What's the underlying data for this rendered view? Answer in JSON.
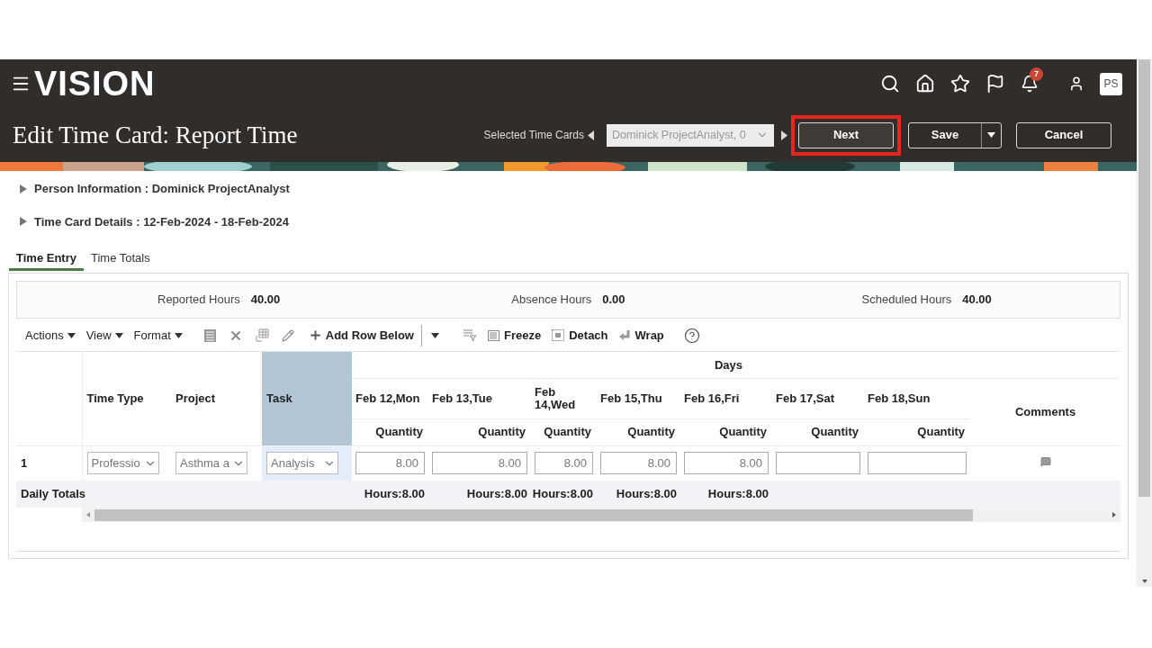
{
  "app": {
    "logo": "VISION",
    "notification_count": "7",
    "avatar": "PS"
  },
  "page_title": "Edit Time Card: Report Time",
  "selector": {
    "label": "Selected Time Cards",
    "value": "Dominick ProjectAnalyst, 0"
  },
  "buttons": [
    {
      "label": "Next",
      "highlighted": true
    },
    {
      "label": "Save",
      "highlighted": false
    },
    {
      "label": "Cancel",
      "highlighted": false
    }
  ],
  "sections": [
    {
      "label": "Person Information : Dominick ProjectAnalyst",
      "expanded": false
    },
    {
      "label": "Time Card Details : 12-Feb-2024 - 18-Feb-2024",
      "expanded": false
    }
  ],
  "tabs": [
    {
      "label": "Time Entry",
      "selected": true
    },
    {
      "label": "Time Totals",
      "selected": false
    }
  ],
  "summary": [
    {
      "label": "Reported Hours",
      "value": "40.00"
    },
    {
      "label": "Absence Hours",
      "value": "0.00"
    },
    {
      "label": "Scheduled Hours",
      "value": "40.00"
    }
  ],
  "toolbar": {
    "menus": [
      "Actions",
      "View",
      "Format"
    ],
    "add_row": "Add Row Below",
    "freeze": "Freeze",
    "detach": "Detach",
    "wrap": "Wrap"
  },
  "table": {
    "columns": [
      {
        "label": "Time Type",
        "selected": false
      },
      {
        "label": "Project",
        "selected": false
      },
      {
        "label": "Task",
        "selected": true
      }
    ],
    "group_label": "Days",
    "days": [
      {
        "date": "Feb 12,Mon",
        "unit": "Quantity"
      },
      {
        "date": "Feb 13,Tue",
        "unit": "Quantity"
      },
      {
        "date": "Feb 14,Wed",
        "unit": "Quantity"
      },
      {
        "date": "Feb 15,Thu",
        "unit": "Quantity"
      },
      {
        "date": "Feb 16,Fri",
        "unit": "Quantity"
      },
      {
        "date": "Feb 17,Sat",
        "unit": "Quantity"
      },
      {
        "date": "Feb 18,Sun",
        "unit": "Quantity"
      }
    ],
    "comments_label": "Comments",
    "rows": [
      {
        "number": "1",
        "cells": [
          "Professio",
          "Asthma a",
          "Analysis"
        ],
        "quantities": [
          "8.00",
          "8.00",
          "8.00",
          "8.00",
          "8.00"
        ]
      }
    ],
    "totals": {
      "label": "Daily Totals",
      "values": [
        "Hours:8.00",
        "Hours:8.00",
        "Hours:8.00",
        "Hours:8.00",
        "Hours:8.00"
      ]
    }
  }
}
